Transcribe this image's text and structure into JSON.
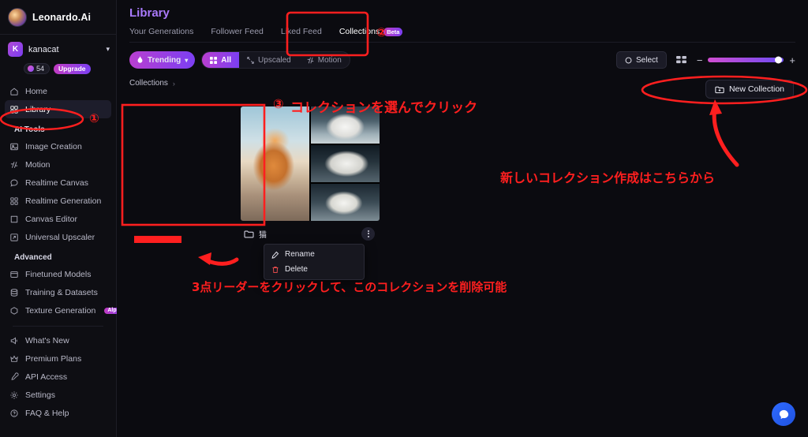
{
  "brand": {
    "name": "Leonardo.Ai"
  },
  "account": {
    "initial": "K",
    "username": "kanacat",
    "caret": "▾",
    "credits": "54",
    "upgrade_label": "Upgrade"
  },
  "sidebar": {
    "primary": [
      {
        "label": "Home",
        "icon": "home-icon",
        "active": false
      },
      {
        "label": "Library",
        "icon": "library-icon",
        "active": true
      }
    ],
    "ai_tools_title": "AI Tools",
    "ai_tools": [
      {
        "label": "Image Creation",
        "icon": "image-creation-icon"
      },
      {
        "label": "Motion",
        "icon": "motion-icon"
      },
      {
        "label": "Realtime Canvas",
        "icon": "realtime-canvas-icon"
      },
      {
        "label": "Realtime Generation",
        "icon": "realtime-generation-icon"
      },
      {
        "label": "Canvas Editor",
        "icon": "canvas-editor-icon"
      },
      {
        "label": "Universal Upscaler",
        "icon": "upscaler-icon"
      }
    ],
    "advanced_title": "Advanced",
    "advanced": [
      {
        "label": "Finetuned Models",
        "icon": "finetuned-models-icon",
        "badge": ""
      },
      {
        "label": "Training & Datasets",
        "icon": "training-datasets-icon",
        "badge": ""
      },
      {
        "label": "Texture Generation",
        "icon": "texture-generation-icon",
        "badge": "Alpha"
      }
    ],
    "footer": [
      {
        "label": "What's New",
        "icon": "whats-new-icon"
      },
      {
        "label": "Premium Plans",
        "icon": "premium-plans-icon"
      },
      {
        "label": "API Access",
        "icon": "api-access-icon"
      },
      {
        "label": "Settings",
        "icon": "settings-icon"
      },
      {
        "label": "FAQ & Help",
        "icon": "faq-help-icon"
      }
    ]
  },
  "main": {
    "title": "Library",
    "tabs": [
      {
        "label": "Your Generations",
        "active": false,
        "badge": ""
      },
      {
        "label": "Follower Feed",
        "active": false,
        "badge": ""
      },
      {
        "label": "Liked Feed",
        "active": false,
        "badge": ""
      },
      {
        "label": "Collections",
        "active": true,
        "badge": "Beta"
      }
    ],
    "toolbar": {
      "trending_label": "Trending",
      "trending_caret": "▾",
      "all_label": "All",
      "upscaled_label": "Upscaled",
      "motion_label": "Motion",
      "select_label": "Select",
      "grid_icon": "grid-view-icon",
      "zoom_minus": "−",
      "zoom_plus": "+"
    },
    "breadcrumb": {
      "root": "Collections",
      "separator": "›"
    },
    "new_collection_label": "New Collection",
    "collection": {
      "name": "猫",
      "folder_icon": "folder-icon",
      "kebab_icon": "kebab-menu-icon"
    },
    "context_menu": [
      {
        "label": "Rename",
        "icon": "rename-icon"
      },
      {
        "label": "Delete",
        "icon": "trash-icon"
      }
    ]
  },
  "annotations": {
    "badge1": "①",
    "badge2": "②",
    "badge3": "③",
    "step3_text": "コレクションを選んでクリック",
    "new_collection_text": "新しいコレクション作成はこちらから",
    "delete_text": "3点リーダーをクリックして、このコレクションを削除可能",
    "color": "#ff1f1f"
  }
}
